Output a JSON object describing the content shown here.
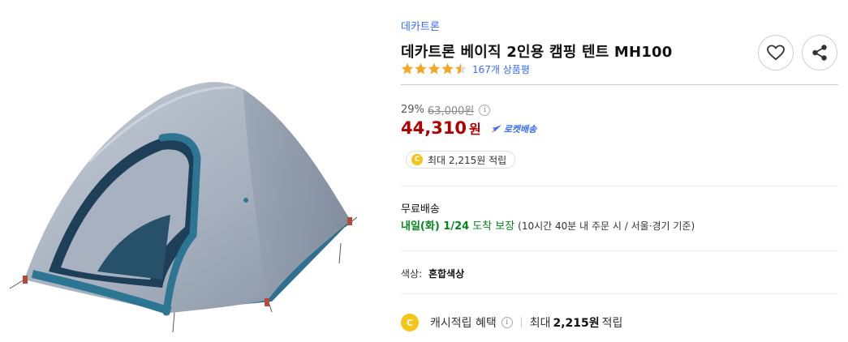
{
  "product": {
    "brand": "데카트론",
    "title": "데카트론 베이직 2인용 캠핑 텐트 MH100",
    "rating": 4.5,
    "review_count": "167개 상품평"
  },
  "actions": {
    "wishlist_icon": "heart-icon",
    "share_icon": "share-icon"
  },
  "price": {
    "discount_rate": "29%",
    "original_price": "63,000원",
    "sale_price": "44,310",
    "currency": "원",
    "rocket_label": "로켓배송"
  },
  "cash_pill": {
    "coin": "C",
    "text": "최대 2,215원 적립"
  },
  "shipping": {
    "label": "무료배송",
    "arrival_date": "내일(화) 1/24",
    "arrival_text": "도착 보장",
    "arrival_note": "(10시간 40분  내 주문 시 / 서울·경기 기준)"
  },
  "option": {
    "label": "색상:",
    "value": "혼합색상"
  },
  "cash_benefit": {
    "coin": "C",
    "label": "캐시적립 혜택",
    "prefix": "최대",
    "amount": "2,215원",
    "suffix": "적립"
  },
  "colors": {
    "accent_blue": "#346aff",
    "sale_red": "#ae0000",
    "arrival_green": "#00891a",
    "star_orange": "#f5a623",
    "coin_yellow": "#f5c518"
  }
}
